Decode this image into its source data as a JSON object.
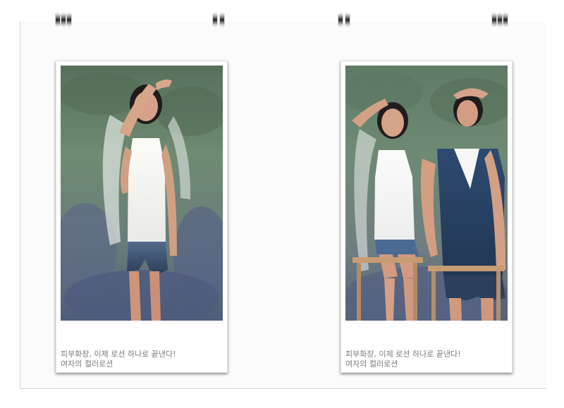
{
  "page": {
    "background": "#ffffff"
  },
  "cards": [
    {
      "caption_line_1": "피부화장, 이제 로션 하나로 끝낸다!",
      "caption_line_2": "여자의 컬러로션"
    },
    {
      "caption_line_1": "피부화장, 이제 로션 하나로 끝낸다!",
      "caption_line_2": "여자의 컬러로션"
    }
  ],
  "colors": {
    "caption_text": "#7c7c7c",
    "card_border": "#e5e5e5",
    "sheet_line": "#d7d7d7"
  }
}
